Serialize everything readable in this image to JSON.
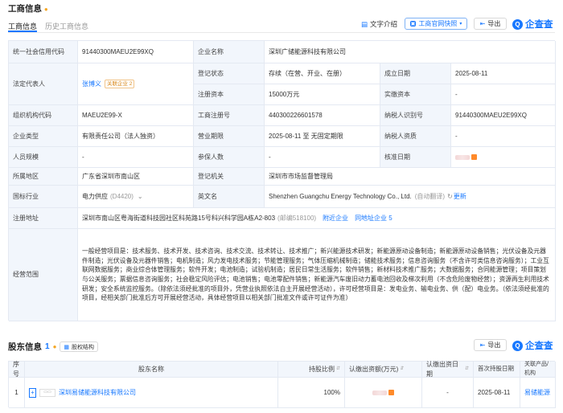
{
  "header": {
    "title": "工商信息",
    "tabs": [
      "工商信息",
      "历史工商信息"
    ],
    "text_intro": "文字介绍",
    "snapshot": "工商官网快照",
    "export": "导出",
    "brand": "企查查"
  },
  "info": {
    "credit_code_label": "统一社会信用代码",
    "credit_code": "91440300MAEU2E99XQ",
    "name_label": "企业名称",
    "name": "深圳广储能源科技有限公司",
    "legal_rep_label": "法定代表人",
    "legal_rep": "张博义",
    "legal_rep_tag": "关联企业 2",
    "status_label": "登记状态",
    "status": "存续（在营、开业、在册）",
    "est_date_label": "成立日期",
    "est_date": "2025-08-11",
    "reg_cap_label": "注册资本",
    "reg_cap": "15000万元",
    "paid_cap_label": "实缴资本",
    "paid_cap": "-",
    "org_code_label": "组织机构代码",
    "org_code": "MAEU2E99-X",
    "reg_no_label": "工商注册号",
    "reg_no": "440300226601578",
    "taxpayer_id_label": "纳税人识别号",
    "taxpayer_id": "91440300MAEU2E99XQ",
    "type_label": "企业类型",
    "type": "有限责任公司（法人独资）",
    "term_label": "营业期限",
    "term": "2025-08-11 至 无固定期限",
    "taxpayer_q_label": "纳税人资质",
    "taxpayer_q": "-",
    "staff_label": "人员规模",
    "staff": "-",
    "insured_label": "参保人数",
    "insured": "-",
    "approve_label": "核准日期",
    "region_label": "所属地区",
    "region": "广东省深圳市南山区",
    "authority_label": "登记机关",
    "authority": "深圳市市场监督管理局",
    "industry_label": "国标行业",
    "industry": "电力供应",
    "industry_code": "(D4420)",
    "en_name_label": "英文名",
    "en_name": "Shenzhen Guangchu Energy Technology Co., Ltd.",
    "en_name_note": "(自动翻译)",
    "update": "更新",
    "address_label": "注册地址",
    "address": "深圳市南山区粤海街道科技园社区科苑路15号科兴科学园A栋A2-803",
    "postcode": "(邮编518100)",
    "nearby": "附近企业",
    "same_addr": "同地址企业 5",
    "scope_label": "经营范围",
    "scope": "一般经营项目是：技术服务、技术开发、技术咨询、技术交流、技术转让、技术推广；新兴能源技术研发；新能源原动设备制造；新能源原动设备销售；光伏设备及元器件制造；光伏设备及元器件销售；电机制造；风力发电技术服务；节能管理服务；气体压缩机械制造；储能技术服务；信息咨询服务（不含许可类信息咨询服务）；工业互联网数据服务；商业综合体管理服务；软件开发；电池制造；试验机制造；居民日常生活服务；软件销售；新材料技术推广服务；大数据服务；合同能源管理；项目策划与公关服务；票据信息咨询服务；社会稳定风险评估；电池销售；电池零配件销售；新能源汽车废旧动力蓄电池回收及梯次利用（不含危险废物经营）；资源再生利用技术研发；安全系统监控服务。（除依法须经批准的项目外，凭营业执照依法自主开展经营活动），许可经营项目是：发电业务、输电业务、供（配）电业务。（依法须经批准的项目，经相关部门批准后方可开展经营活动，具体经营项目以相关部门批准文件或许可证件为准）"
  },
  "shareholders": {
    "title": "股东信息",
    "count": "1",
    "equity_btn": "股权结构",
    "export": "导出",
    "brand": "企查查",
    "columns": [
      "序号",
      "股东名称",
      "持股比例",
      "认缴出资额(万元)",
      "认缴出资日期",
      "首次持股日期",
      "关联产品/机构"
    ],
    "rows": [
      {
        "idx": "1",
        "name": "深圳易储能源科技有限公司",
        "ratio": "100%",
        "amount": "",
        "date": "-",
        "first": "2025-08-11",
        "product": "易储能源"
      }
    ]
  },
  "colors": {
    "accent": "#1677ff",
    "label_bg": "#f2f6fc",
    "border": "#e4e9f2"
  }
}
